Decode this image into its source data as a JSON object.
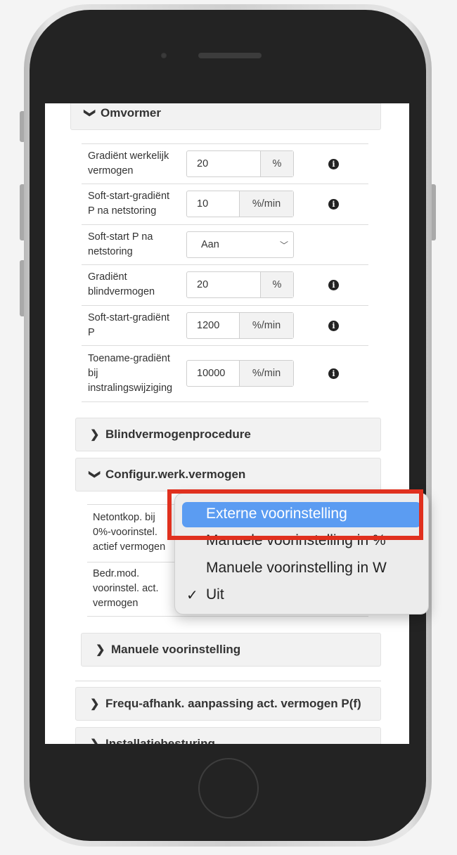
{
  "sections": {
    "omvormer": "Omvormer",
    "blindvermogen": "Blindvermogenprocedure",
    "configur": "Configur.werk.vermogen",
    "manuele": "Manuele voorinstelling",
    "frequ": "Frequ-afhank. aanpassing act. vermogen P(f)",
    "installatie": "Installatiebesturing"
  },
  "omvormer_rows": [
    {
      "label_1": "Gradiënt werkelijk",
      "label_2": "vermogen",
      "value": "20",
      "unit": "%"
    },
    {
      "label_1": "Soft-start-gradiënt",
      "label_2": "P na netstoring",
      "value": "10",
      "unit": "%/min"
    },
    {
      "label_1": "Soft-start P na",
      "label_2": "netstoring",
      "value": "Aan"
    },
    {
      "label_1": "Gradiënt",
      "label_2": "blindvermogen",
      "value": "20",
      "unit": "%"
    },
    {
      "label_1": "Soft-start-gradiënt",
      "label_2": "P",
      "value": "1200",
      "unit": "%/min"
    },
    {
      "label_1": "Toename-gradiënt",
      "label_2": "bij",
      "label_3": "instralingswijziging",
      "value": "10000",
      "unit": "%/min"
    }
  ],
  "configur_rows": [
    {
      "label_1": "Netontkop. bij",
      "label_2": "0%-voorinstel.",
      "label_3": "actief vermogen"
    },
    {
      "label_1": "Bedr.mod.",
      "label_2": "voorinstel. act.",
      "label_3": "vermogen"
    }
  ],
  "popup": {
    "items": [
      "Externe voorinstelling",
      "Manuele voorinstelling in %",
      "Manuele voorinstelling in W",
      "Uit"
    ],
    "highlighted": "Externe voorinstelling",
    "checked": "Uit",
    "check_mark": "✓"
  },
  "icons": {
    "chevron_down": "❯",
    "info": "i"
  },
  "colors": {
    "highlight_blue": "#5b9cf2",
    "annotation_red": "#e0301e"
  }
}
